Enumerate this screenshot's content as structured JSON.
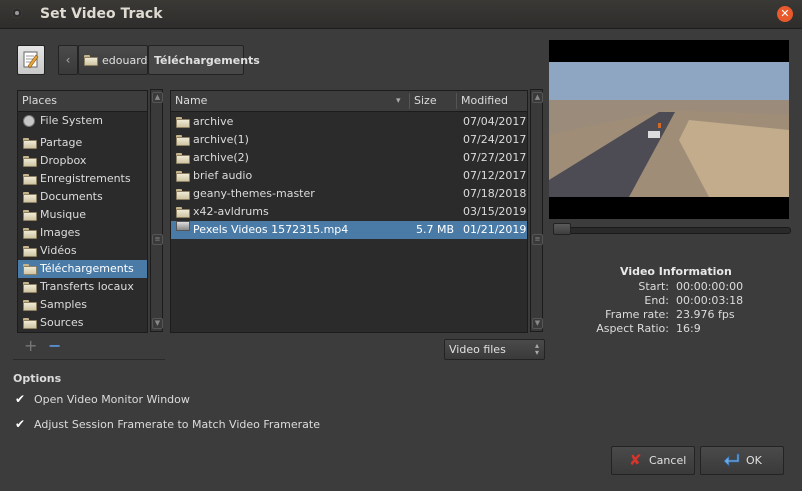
{
  "window": {
    "title": "Set Video Track"
  },
  "breadcrumb": {
    "items": [
      "edouard",
      "Téléchargements"
    ]
  },
  "places": {
    "header": "Places",
    "items": [
      {
        "label": "File System",
        "icon": "drive-icon"
      },
      {
        "label": "Partage",
        "icon": "folder-icon"
      },
      {
        "label": "Dropbox",
        "icon": "folder-icon"
      },
      {
        "label": "Enregistrements",
        "icon": "folder-icon"
      },
      {
        "label": "Documents",
        "icon": "folder-icon"
      },
      {
        "label": "Musique",
        "icon": "folder-icon"
      },
      {
        "label": "Images",
        "icon": "folder-icon"
      },
      {
        "label": "Vidéos",
        "icon": "folder-icon"
      },
      {
        "label": "Téléchargements",
        "icon": "folder-icon",
        "selected": true
      },
      {
        "label": "Transferts locaux",
        "icon": "folder-icon"
      },
      {
        "label": "Samples",
        "icon": "folder-icon"
      },
      {
        "label": "Sources",
        "icon": "folder-icon"
      }
    ]
  },
  "files": {
    "columns": {
      "name": "Name",
      "size": "Size",
      "modified": "Modified"
    },
    "rows": [
      {
        "name": "archive",
        "size": "",
        "modified": "07/04/2017",
        "type": "folder"
      },
      {
        "name": "archive(1)",
        "size": "",
        "modified": "07/24/2017",
        "type": "folder"
      },
      {
        "name": "archive(2)",
        "size": "",
        "modified": "07/27/2017",
        "type": "folder"
      },
      {
        "name": "brief audio",
        "size": "",
        "modified": "07/12/2017",
        "type": "folder"
      },
      {
        "name": "geany-themes-master",
        "size": "",
        "modified": "07/18/2018",
        "type": "folder"
      },
      {
        "name": "x42-avldrums",
        "size": "",
        "modified": "03/15/2019",
        "type": "folder"
      },
      {
        "name": "Pexels Videos 1572315.mp4",
        "size": "5.7 MB",
        "modified": "01/21/2019",
        "type": "video",
        "selected": true
      }
    ]
  },
  "filter": {
    "value": "Video files"
  },
  "options": {
    "title": "Options",
    "items": [
      {
        "label": "Open Video Monitor Window",
        "checked": true
      },
      {
        "label": "Adjust Session Framerate to Match Video Framerate",
        "checked": true
      }
    ]
  },
  "video_info": {
    "title": "Video Information",
    "fields": [
      {
        "key": "Start:",
        "value": "00:00:00:00"
      },
      {
        "key": "End:",
        "value": "00:00:03:18"
      },
      {
        "key": "Frame rate:",
        "value": "23.976 fps"
      },
      {
        "key": "Aspect Ratio:",
        "value": "16:9"
      }
    ]
  },
  "buttons": {
    "cancel": "Cancel",
    "ok": "OK"
  },
  "colors": {
    "selection": "#4a7ba7",
    "close": "#e8592c"
  }
}
